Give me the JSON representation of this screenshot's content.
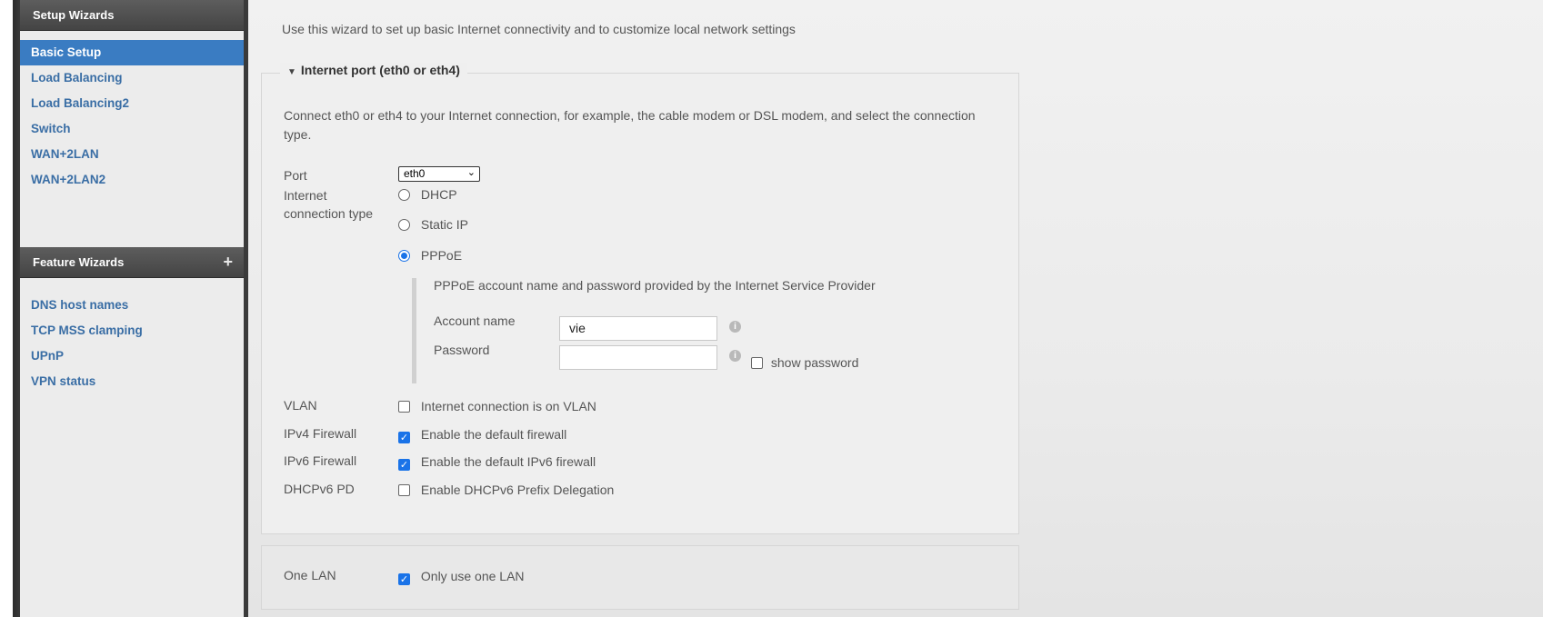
{
  "sidebar": {
    "setup_header": "Setup Wizards",
    "setup_items": [
      "Basic Setup",
      "Load Balancing",
      "Load Balancing2",
      "Switch",
      "WAN+2LAN",
      "WAN+2LAN2"
    ],
    "active_item": "Basic Setup",
    "feature_header": "Feature Wizards",
    "feature_items": [
      "DNS host names",
      "TCP MSS clamping",
      "UPnP",
      "VPN status"
    ]
  },
  "main": {
    "intro": "Use this wizard to set up basic Internet connectivity and to customize local network settings",
    "internet_panel": {
      "title": "Internet port (eth0 or eth4)",
      "description": "Connect eth0 or eth4 to your Internet connection, for example, the cable modem or DSL modem, and select the connection type.",
      "port_label": "Port",
      "port_value": "eth0",
      "connection_type_label_line1": "Internet",
      "connection_type_label_line2": "connection type",
      "connection_options": [
        "DHCP",
        "Static IP",
        "PPPoE"
      ],
      "selected_connection": "PPPoE",
      "pppoe_note": "PPPoE account name and password provided by the Internet Service Provider",
      "account_name_label": "Account name",
      "account_name_value": "vie",
      "password_label": "Password",
      "password_value": "",
      "show_password_label": "show password",
      "show_password_checked": false,
      "vlan_label": "VLAN",
      "vlan_option": "Internet connection is on VLAN",
      "vlan_checked": false,
      "ipv4_label": "IPv4 Firewall",
      "ipv4_option": "Enable the default firewall",
      "ipv4_checked": true,
      "ipv6_label": "IPv6 Firewall",
      "ipv6_option": "Enable the default IPv6 firewall",
      "ipv6_checked": true,
      "dhcpv6_label": "DHCPv6 PD",
      "dhcpv6_option": "Enable DHCPv6 Prefix Delegation",
      "dhcpv6_checked": false
    },
    "lan_panel": {
      "one_lan_label": "One LAN",
      "one_lan_option": "Only use one LAN",
      "one_lan_checked": true
    }
  },
  "colors": {
    "accent": "#1a73e8",
    "active_nav": "#3a7cc2",
    "nav_link": "#3a6ea5",
    "sidebar_header": "#4f4f4f"
  }
}
